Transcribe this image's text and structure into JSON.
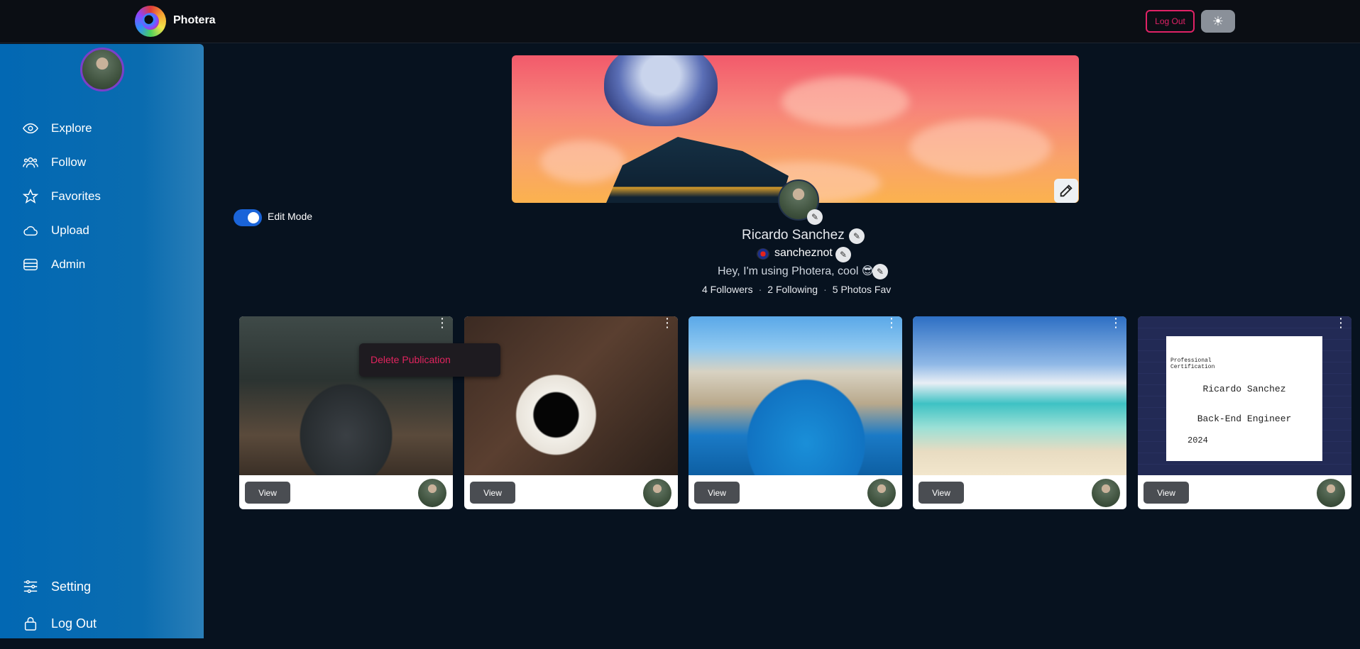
{
  "header": {
    "brand": "Photera",
    "logout_label": "Log Out",
    "theme_icon": "sun-icon"
  },
  "sidebar": {
    "items": [
      {
        "label": "Explore",
        "icon": "eye-icon"
      },
      {
        "label": "Follow",
        "icon": "users-icon"
      },
      {
        "label": "Favorites",
        "icon": "star-icon"
      },
      {
        "label": "Upload",
        "icon": "cloud-icon"
      },
      {
        "label": "Admin",
        "icon": "database-icon"
      }
    ],
    "bottom_items": [
      {
        "label": "Setting",
        "icon": "sliders-icon"
      },
      {
        "label": "Log Out",
        "icon": "lock-icon"
      }
    ]
  },
  "profile": {
    "edit_mode_label": "Edit Mode",
    "edit_mode_on": true,
    "name": "Ricardo Sanchez",
    "username": "sancheznot",
    "bio": "Hey, I'm using Photera, cool 😎",
    "followers": "4 Followers",
    "following": "2 Following",
    "photos_fav": "5 Photos Fav"
  },
  "context_menu": {
    "item": "Delete Publication"
  },
  "cards": [
    {
      "view_label": "View",
      "subject": "car"
    },
    {
      "view_label": "View",
      "subject": "coffee"
    },
    {
      "view_label": "View",
      "subject": "cliff-beach"
    },
    {
      "view_label": "View",
      "subject": "tropical-beach"
    },
    {
      "view_label": "View",
      "subject": "certificate"
    }
  ],
  "certificate": {
    "heading": "Professional Certification",
    "name": "Ricardo Sanchez",
    "role": "Back-End Engineer",
    "year": "2024"
  }
}
